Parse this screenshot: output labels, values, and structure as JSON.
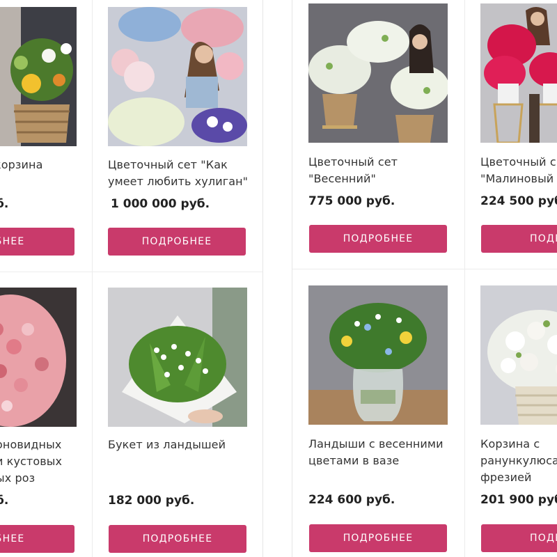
{
  "brand_color": "#c93a6b",
  "products": [
    {
      "id": "p1",
      "title_lines": [
        "корзина",
        ""
      ],
      "price": "б.",
      "button": "ОБНЕЕ"
    },
    {
      "id": "p2",
      "title_lines": [
        "Цветочный сет \"Как",
        "умеет любить хулиган\""
      ],
      "price": "1 000 000 руб.",
      "button": "ПОДРОБНЕЕ"
    },
    {
      "id": "p3",
      "title_lines": [
        "Цветочный сет",
        "\"Весенний\""
      ],
      "price": "775 000 руб.",
      "button": "ПОДРОБНЕЕ"
    },
    {
      "id": "p4",
      "title_lines": [
        "Цветочный с",
        "\"Малиновый ц"
      ],
      "price": "224 500 руб.",
      "button": "ПОДРО"
    },
    {
      "id": "p5",
      "title_lines": [
        "оновидных",
        "и кустовых",
        "ых роз"
      ],
      "price": "б.",
      "button": "ОБНЕЕ"
    },
    {
      "id": "p6",
      "title_lines": [
        "Букет из ландышей"
      ],
      "price": "182 000 руб.",
      "button": "ПОДРОБНЕЕ"
    },
    {
      "id": "p7",
      "title_lines": [
        "Ландыши с весенними",
        "цветами в вазе"
      ],
      "price": "224 600 руб.",
      "button": "ПОДРОБНЕЕ"
    },
    {
      "id": "p8",
      "title_lines": [
        "Корзина с",
        "ранункулюсам",
        "фрезией"
      ],
      "price": "201 900 руб.",
      "button": "ПОДРО"
    }
  ]
}
